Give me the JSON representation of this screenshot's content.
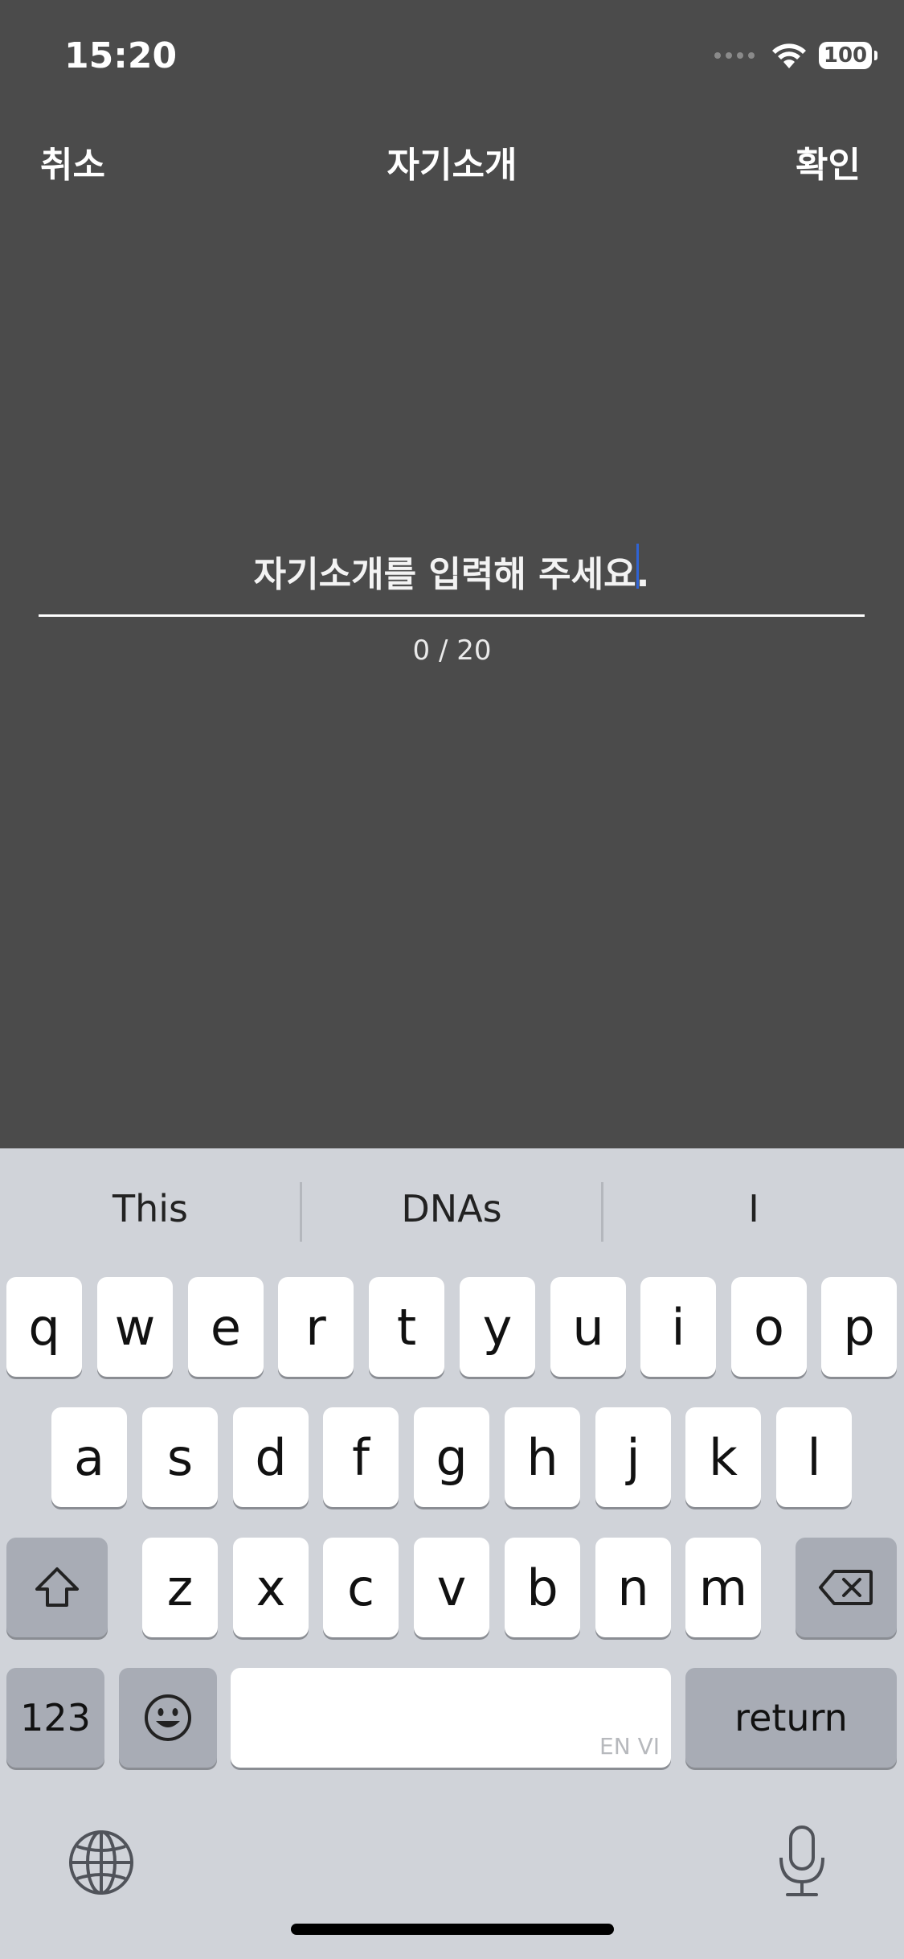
{
  "status_bar": {
    "time": "15:20",
    "battery": "100"
  },
  "nav": {
    "cancel_label": "취소",
    "title": "자기소개",
    "confirm_label": "확인"
  },
  "input": {
    "placeholder": "자기소개를 입력해 주세요.",
    "value": "",
    "counter": "0 / 20"
  },
  "keyboard": {
    "suggestions": [
      "This",
      "DNAs",
      "I"
    ],
    "row1": [
      "q",
      "w",
      "e",
      "r",
      "t",
      "y",
      "u",
      "i",
      "o",
      "p"
    ],
    "row2": [
      "a",
      "s",
      "d",
      "f",
      "g",
      "h",
      "j",
      "k",
      "l"
    ],
    "row3": [
      "z",
      "x",
      "c",
      "v",
      "b",
      "n",
      "m"
    ],
    "numbers_label": "123",
    "space_hint": "EN VI",
    "return_label": "return",
    "icons": {
      "shift": "shift-icon",
      "backspace": "backspace-icon",
      "emoji": "emoji-icon",
      "globe": "globe-icon",
      "mic": "microphone-icon"
    }
  }
}
